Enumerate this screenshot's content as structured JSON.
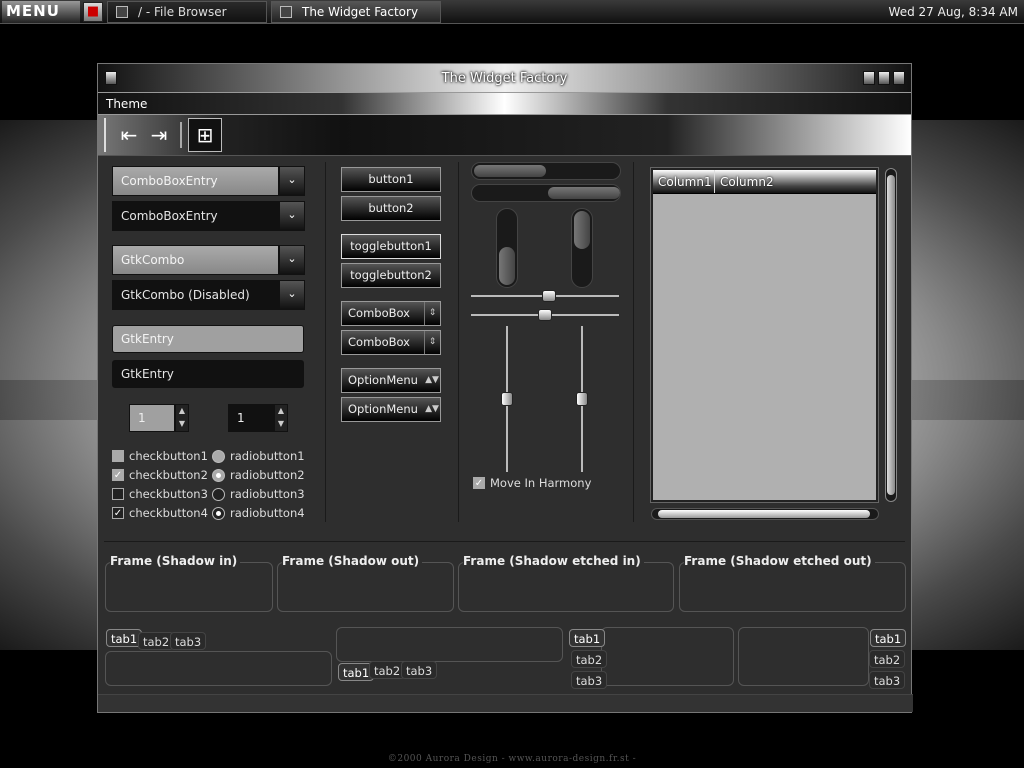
{
  "panel": {
    "menu_label": "MENU",
    "tasks": [
      {
        "label": "/ - File Browser"
      },
      {
        "label": "The Widget Factory"
      }
    ],
    "clock": "Wed 27 Aug,  8:34 AM"
  },
  "window": {
    "title": "The Widget Factory",
    "menu": [
      "Theme"
    ]
  },
  "col1": {
    "combos": [
      "ComboBoxEntry",
      "ComboBoxEntry",
      "GtkCombo",
      "GtkCombo (Disabled)"
    ],
    "entries": [
      "GtkEntry",
      "GtkEntry"
    ],
    "spins": [
      "1",
      "1"
    ],
    "checks": [
      {
        "label": "checkbutton1",
        "checked": false
      },
      {
        "label": "checkbutton2",
        "checked": true
      },
      {
        "label": "checkbutton3",
        "checked": false
      },
      {
        "label": "checkbutton4",
        "checked": true
      }
    ],
    "radios": [
      {
        "label": "radiobutton1",
        "selected": false
      },
      {
        "label": "radiobutton2",
        "selected": true
      },
      {
        "label": "radiobutton3",
        "selected": false
      },
      {
        "label": "radiobutton4",
        "selected": true
      }
    ]
  },
  "col2": {
    "buttons": [
      "button1",
      "button2"
    ],
    "toggles": [
      "togglebutton1",
      "togglebutton2"
    ],
    "comboboxes": [
      "ComboBox",
      "ComboBox"
    ],
    "optionmenus": [
      "OptionMenu",
      "OptionMenu"
    ]
  },
  "col3": {
    "harmony_label": "Move In Harmony",
    "harmony_checked": true
  },
  "tree": {
    "columns": [
      "Column1",
      "Column2"
    ]
  },
  "frames": [
    "Frame (Shadow in)",
    "Frame (Shadow out)",
    "Frame (Shadow etched in)",
    "Frame (Shadow etched out)"
  ],
  "tabs": [
    "tab1",
    "tab2",
    "tab3"
  ],
  "credit": "©2000 Aurora Design  -  www.aurora-design.fr.st  -"
}
